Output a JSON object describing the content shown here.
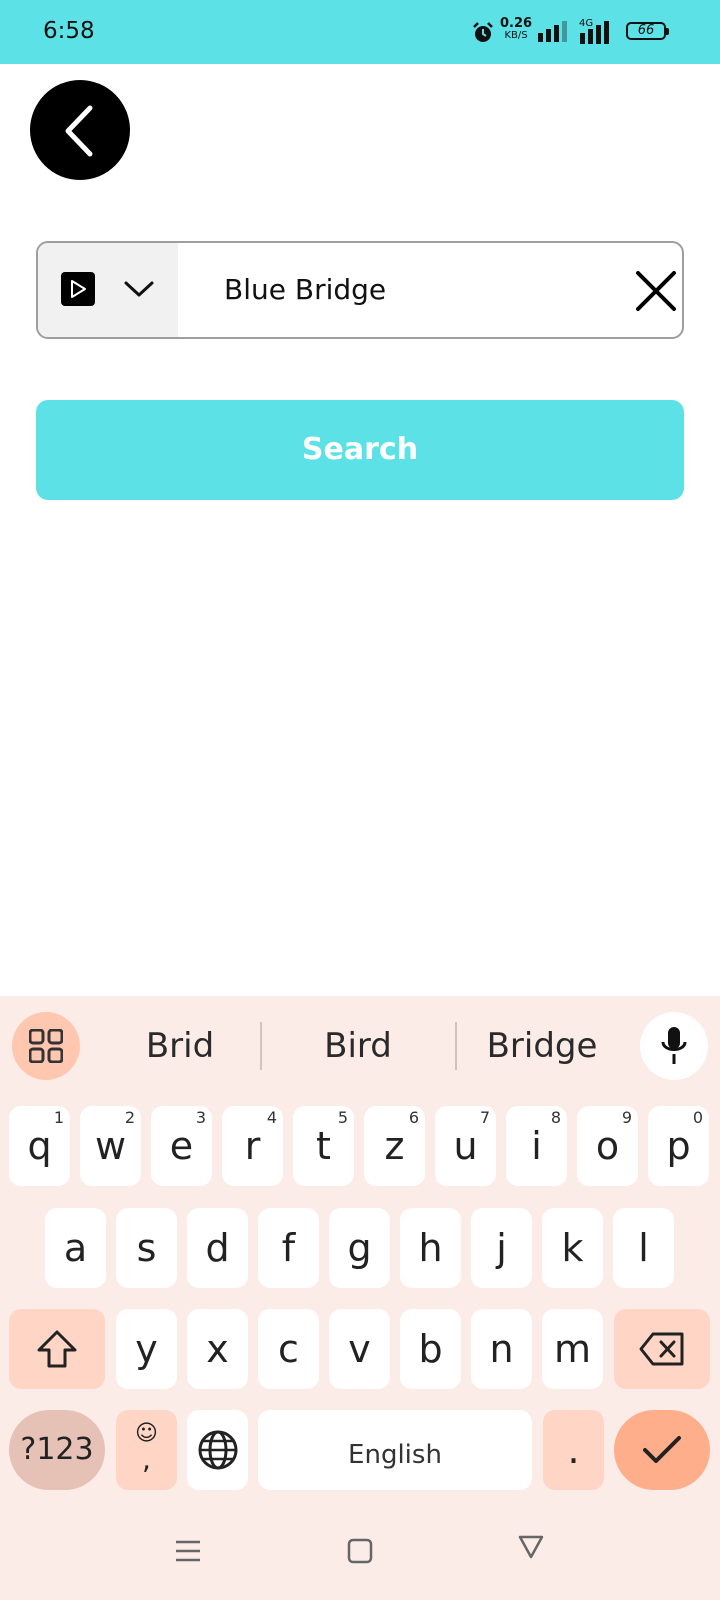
{
  "status_bar": {
    "time": "6:58",
    "net_speed": "0.26",
    "net_speed_unit": "KB/S",
    "network": "4G",
    "battery": "66"
  },
  "search": {
    "query": "Blue Bridge",
    "button_label": "Search",
    "source_icon": "play-icon"
  },
  "colors": {
    "accent": "#5ce1e6",
    "keyboard_bg": "#fbece8",
    "key_func": "#ffd6c6",
    "key_confirm": "#ffae8c"
  },
  "keyboard": {
    "suggestions": [
      "Brid",
      "Bird",
      "Bridge"
    ],
    "row1": [
      {
        "label": "q",
        "num": "1"
      },
      {
        "label": "w",
        "num": "2"
      },
      {
        "label": "e",
        "num": "3"
      },
      {
        "label": "r",
        "num": "4"
      },
      {
        "label": "t",
        "num": "5"
      },
      {
        "label": "z",
        "num": "6"
      },
      {
        "label": "u",
        "num": "7"
      },
      {
        "label": "i",
        "num": "8"
      },
      {
        "label": "o",
        "num": "9"
      },
      {
        "label": "p",
        "num": "0"
      }
    ],
    "row2": [
      "a",
      "s",
      "d",
      "f",
      "g",
      "h",
      "j",
      "k",
      "l"
    ],
    "row3": [
      "y",
      "x",
      "c",
      "v",
      "b",
      "n",
      "m"
    ],
    "symbols_label": "?123",
    "emoji_comma": ",",
    "space_label": "English",
    "period_label": "."
  }
}
